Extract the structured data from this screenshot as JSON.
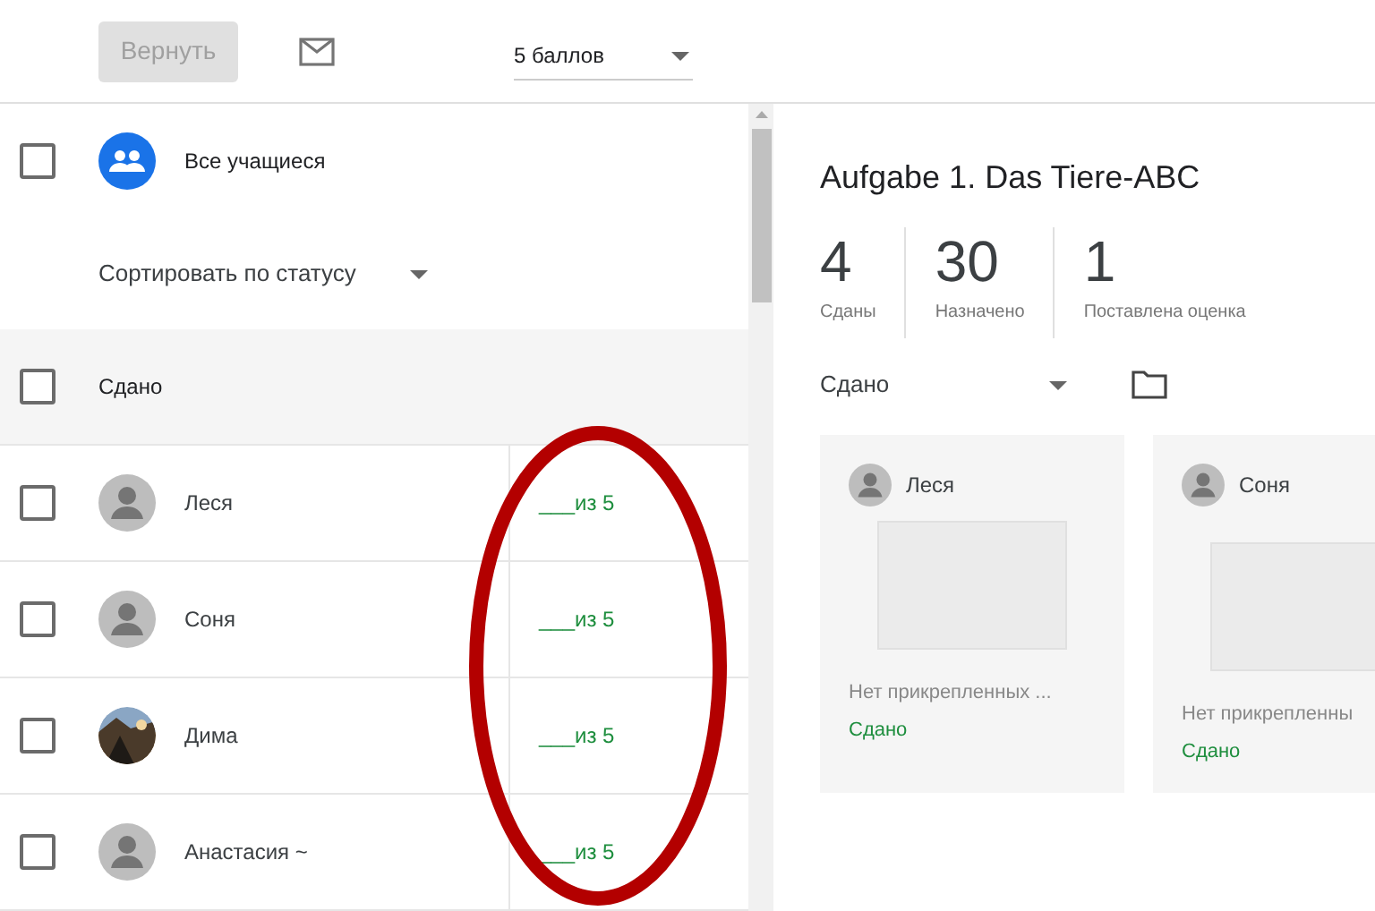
{
  "toolbar": {
    "return_button": {
      "label": "Вернуть",
      "disabled": true
    },
    "points_select": {
      "value": "5 баллов"
    }
  },
  "student_list": {
    "all_students": {
      "label": "Все учащиеся",
      "checked": false
    },
    "sort_select": {
      "value": "Сортировать по статусу"
    },
    "group": {
      "label": "Сдано",
      "checked": false
    },
    "students": [
      {
        "name": "Леся",
        "kind": "default",
        "grade": "___из 5",
        "checked": false
      },
      {
        "name": "Соня",
        "kind": "default",
        "grade": "___из 5",
        "checked": false
      },
      {
        "name": "Дима",
        "grade": "___из 5",
        "checked": false
      },
      {
        "name": "Анастасия ~",
        "kind": "default",
        "grade": "___из 5",
        "checked": false
      }
    ]
  },
  "assignment": {
    "title": "Aufgabe 1. Das Tiere-ABC",
    "stats": [
      {
        "value": "4",
        "label": "Сданы"
      },
      {
        "value": "30",
        "label": "Назначено"
      },
      {
        "value": "1",
        "label": "Поставлена оценка"
      }
    ],
    "filter": {
      "value": "Сдано"
    },
    "cards": [
      {
        "name": "Леся",
        "note": "Нет прикрепленных ...",
        "status": "Сдано"
      },
      {
        "name": "Соня",
        "note": "Нет прикрепленны",
        "status": "Сдано"
      }
    ]
  },
  "annotation": {
    "kind": "ellipse"
  }
}
